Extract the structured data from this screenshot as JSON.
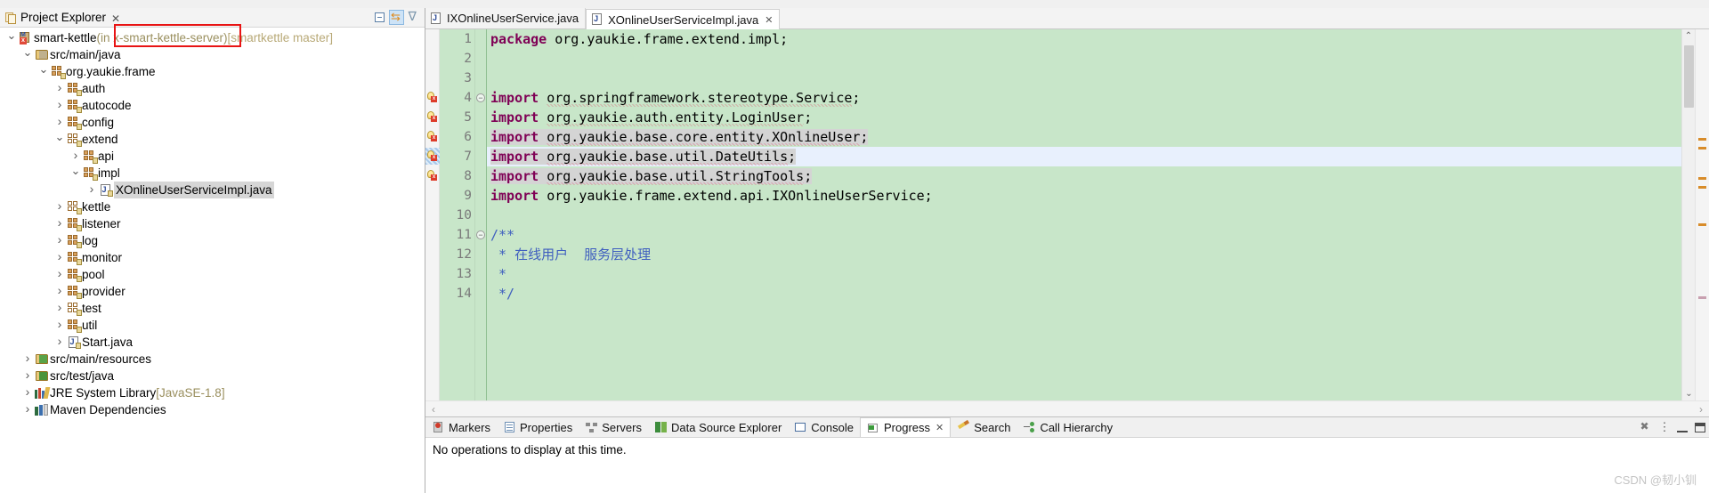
{
  "explorer": {
    "title": "Project Explorer",
    "close_label": "✕",
    "toolbar": {
      "collapse_all": "collapse-all",
      "link_with_editor": "link-with-editor",
      "view_menu": "view-menu"
    },
    "tree": [
      {
        "depth": 0,
        "state": "open",
        "icon": "project-icon",
        "label": "smart-kettle ",
        "suffix": "(in x-smart-kettle-server)",
        "suffix2": " [smartkettle master]"
      },
      {
        "depth": 1,
        "state": "open",
        "icon": "source-folder-icon",
        "label": "src/main/java"
      },
      {
        "depth": 2,
        "state": "open",
        "icon": "package-icon",
        "label": "org.yaukie.frame"
      },
      {
        "depth": 3,
        "state": "closed",
        "icon": "package-icon",
        "label": "auth"
      },
      {
        "depth": 3,
        "state": "closed",
        "icon": "package-icon",
        "label": "autocode"
      },
      {
        "depth": 3,
        "state": "closed",
        "icon": "package-icon",
        "label": "config"
      },
      {
        "depth": 3,
        "state": "open",
        "icon": "package-empty-icon",
        "label": "extend"
      },
      {
        "depth": 4,
        "state": "closed",
        "icon": "package-icon",
        "label": "api"
      },
      {
        "depth": 4,
        "state": "open",
        "icon": "package-icon",
        "label": "impl"
      },
      {
        "depth": 5,
        "state": "closed",
        "icon": "java-file-icon",
        "label": "XOnlineUserServiceImpl.java",
        "selected": true
      },
      {
        "depth": 3,
        "state": "closed",
        "icon": "package-empty-icon",
        "label": "kettle"
      },
      {
        "depth": 3,
        "state": "closed",
        "icon": "package-icon",
        "label": "listener"
      },
      {
        "depth": 3,
        "state": "closed",
        "icon": "package-icon",
        "label": "log"
      },
      {
        "depth": 3,
        "state": "closed",
        "icon": "package-icon",
        "label": "monitor"
      },
      {
        "depth": 3,
        "state": "closed",
        "icon": "package-icon",
        "label": "pool"
      },
      {
        "depth": 3,
        "state": "closed",
        "icon": "package-icon",
        "label": "provider"
      },
      {
        "depth": 3,
        "state": "closed",
        "icon": "package-empty-icon",
        "label": "test"
      },
      {
        "depth": 3,
        "state": "closed",
        "icon": "package-icon",
        "label": "util"
      },
      {
        "depth": 3,
        "state": "closed",
        "icon": "java-file-icon",
        "label": "Start.java"
      },
      {
        "depth": 1,
        "state": "closed",
        "icon": "source-folder-resources-icon",
        "label": "src/main/resources"
      },
      {
        "depth": 1,
        "state": "closed",
        "icon": "source-folder-test-icon",
        "label": "src/test/java"
      },
      {
        "depth": 1,
        "state": "closed",
        "icon": "jre-library-icon",
        "label": "JRE System Library ",
        "suffix": "[JavaSE-1.8]"
      },
      {
        "depth": 1,
        "state": "closed",
        "icon": "maven-deps-icon",
        "label": "Maven Dependencies"
      }
    ],
    "highlight_box_label": "x-smart-kettle-server",
    "highlight_box_color": "#e81414"
  },
  "editor": {
    "tabs": [
      {
        "label": "IXOnlineUserService.java",
        "active": false,
        "closable": false
      },
      {
        "label": "XOnlineUserServiceImpl.java",
        "active": true,
        "closable": true,
        "close_label": "✕"
      }
    ],
    "background_color": "#c8e6c9",
    "current_line_color": "#e8f0fd",
    "occurrence_color": "#d4d4d4",
    "lines": [
      {
        "num": "1",
        "fold": null,
        "marker": null,
        "current": false,
        "tokens": [
          {
            "t": "package",
            "c": "kw"
          },
          {
            "t": " org.yaukie.frame.extend.impl;",
            "c": "plain"
          }
        ]
      },
      {
        "num": "2",
        "fold": null,
        "marker": null,
        "current": false,
        "tokens": []
      },
      {
        "num": "3",
        "fold": null,
        "marker": null,
        "current": false,
        "tokens": []
      },
      {
        "num": "4",
        "fold": "minus",
        "marker": "warning",
        "current": false,
        "tokens": [
          {
            "t": "import",
            "c": "kw"
          },
          {
            "t": " ",
            "c": "plain"
          },
          {
            "t": "org.springframework.stereotype.Service",
            "c": "plain squig"
          },
          {
            "t": ";",
            "c": "plain"
          }
        ]
      },
      {
        "num": "5",
        "fold": null,
        "marker": "warning",
        "current": false,
        "tokens": [
          {
            "t": "import",
            "c": "kw"
          },
          {
            "t": " ",
            "c": "plain"
          },
          {
            "t": "org.yaukie.auth.entity.LoginUser",
            "c": "plain squig"
          },
          {
            "t": ";",
            "c": "plain"
          }
        ]
      },
      {
        "num": "6",
        "fold": null,
        "marker": "warning",
        "current": false,
        "occurrence": true,
        "tokens": [
          {
            "t": "import",
            "c": "kw"
          },
          {
            "t": " ",
            "c": "plain"
          },
          {
            "t": "org.yaukie.base.core.entity.XOnlineUser",
            "c": "plain squig"
          },
          {
            "t": ";",
            "c": "plain"
          }
        ]
      },
      {
        "num": "7",
        "fold": null,
        "marker": "warning-current",
        "current": true,
        "occurrence": true,
        "tokens": [
          {
            "t": "import",
            "c": "kw"
          },
          {
            "t": " ",
            "c": "plain"
          },
          {
            "t": "org.yaukie.base.util.DateUtils",
            "c": "plain squig"
          },
          {
            "t": ";",
            "c": "plain"
          }
        ]
      },
      {
        "num": "8",
        "fold": null,
        "marker": "warning",
        "current": false,
        "occurrence": true,
        "tokens": [
          {
            "t": "import",
            "c": "kw"
          },
          {
            "t": " ",
            "c": "plain"
          },
          {
            "t": "org.yaukie.base.util.StringTools",
            "c": "plain squig"
          },
          {
            "t": ";",
            "c": "plain"
          }
        ]
      },
      {
        "num": "9",
        "fold": null,
        "marker": null,
        "current": false,
        "tokens": [
          {
            "t": "import",
            "c": "kw"
          },
          {
            "t": " org.yaukie.frame.extend.api.IXOnlineUserService;",
            "c": "plain"
          }
        ]
      },
      {
        "num": "10",
        "fold": null,
        "marker": null,
        "current": false,
        "tokens": []
      },
      {
        "num": "11",
        "fold": "minus",
        "marker": null,
        "current": false,
        "tokens": [
          {
            "t": "/**",
            "c": "cmt"
          }
        ]
      },
      {
        "num": "12",
        "fold": null,
        "marker": null,
        "current": false,
        "tokens": [
          {
            "t": " * 在线用户  服务层处理",
            "c": "cmt"
          }
        ]
      },
      {
        "num": "13",
        "fold": null,
        "marker": null,
        "current": false,
        "tokens": [
          {
            "t": " *",
            "c": "cmt"
          }
        ]
      },
      {
        "num": "14",
        "fold": null,
        "marker": null,
        "current": false,
        "tokens": [
          {
            "t": " */",
            "c": "cmt"
          }
        ]
      }
    ],
    "hscroll_left_arrow": "‹",
    "hscroll_right_arrow": "›",
    "vscroll_up_arrow": "⌃",
    "vscroll_down_arrow": "⌄"
  },
  "bottom_panel": {
    "tabs": [
      {
        "label": "Markers",
        "icon": "markers-icon",
        "active": false,
        "closable": false
      },
      {
        "label": "Properties",
        "icon": "properties-icon",
        "active": false,
        "closable": false
      },
      {
        "label": "Servers",
        "icon": "servers-icon",
        "active": false,
        "closable": false
      },
      {
        "label": "Data Source Explorer",
        "icon": "data-source-explorer-icon",
        "active": false,
        "closable": false
      },
      {
        "label": "Console",
        "icon": "console-icon",
        "active": false,
        "closable": false
      },
      {
        "label": "Progress",
        "icon": "progress-icon",
        "active": true,
        "closable": true,
        "close_label": "✕"
      },
      {
        "label": "Search",
        "icon": "search-icon",
        "active": false,
        "closable": false
      },
      {
        "label": "Call Hierarchy",
        "icon": "call-hierarchy-icon",
        "active": false,
        "closable": false
      }
    ],
    "message": "No operations to display at this time.",
    "actions": {
      "terminate_all": "terminate-all",
      "view_menu": "view-menu",
      "minimize": "minimize",
      "maximize": "maximize"
    }
  },
  "watermark": "CSDN @韧小钏"
}
